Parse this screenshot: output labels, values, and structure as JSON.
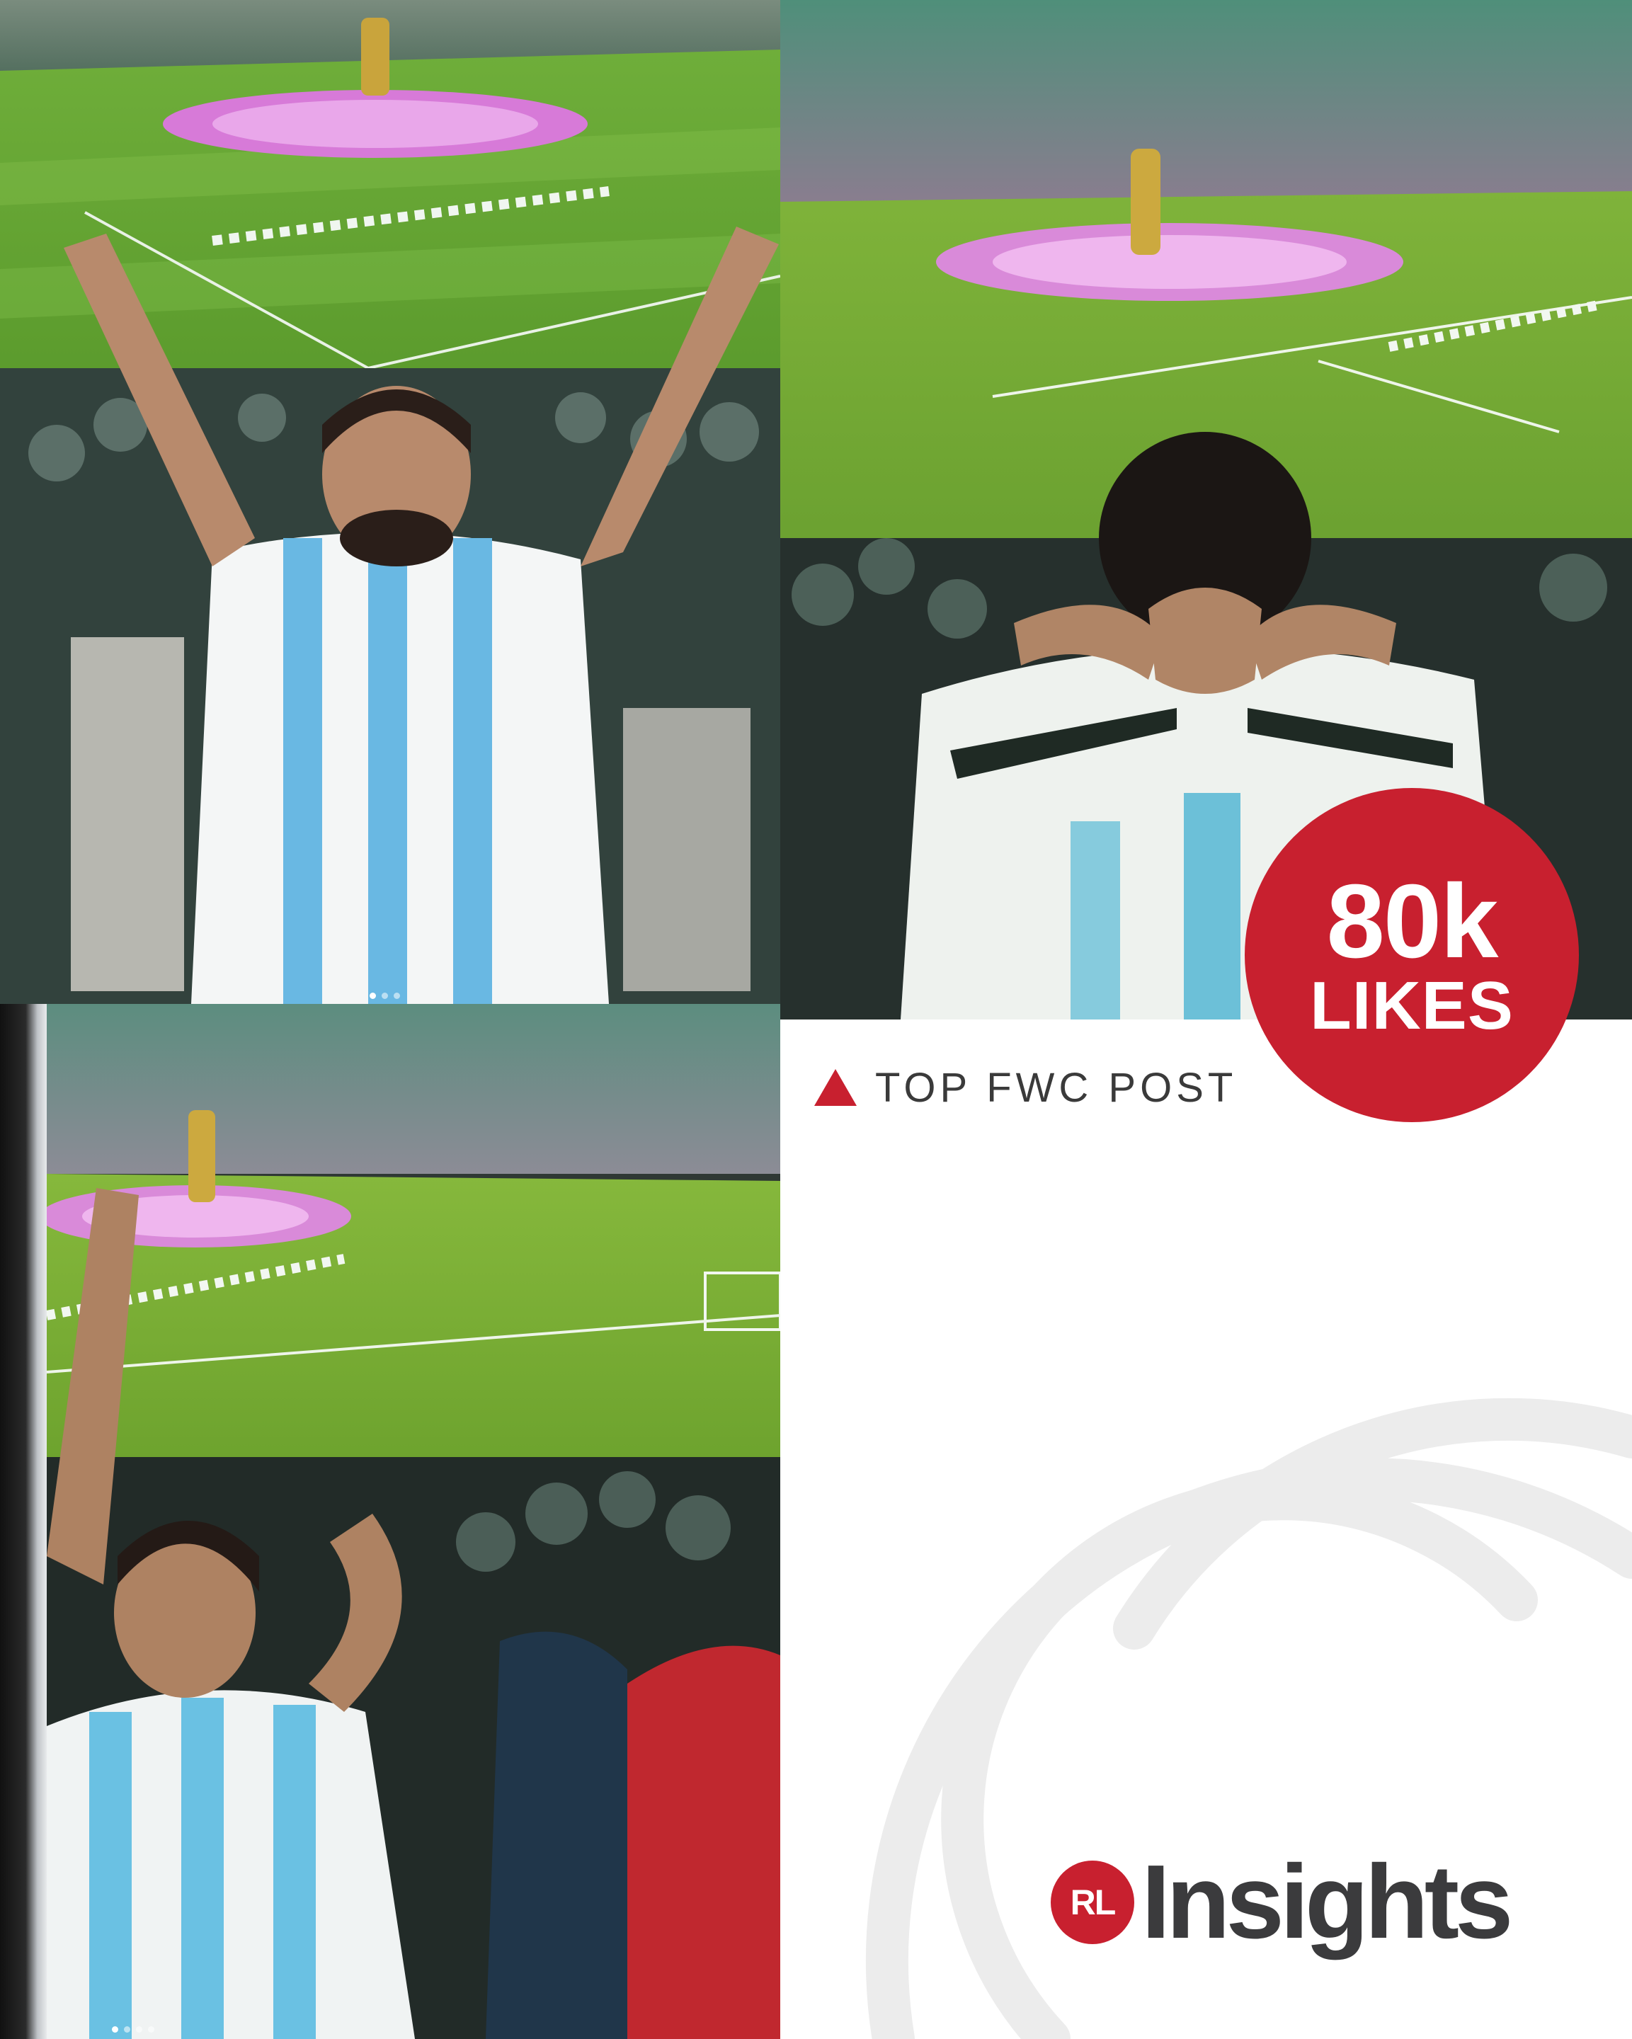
{
  "badge": {
    "count": "80k",
    "label": "LIKES"
  },
  "caption": {
    "text": "TOP FWC POST"
  },
  "brand": {
    "mark": "RL",
    "name": "Insights"
  },
  "colors": {
    "accent": "#c8202f",
    "brand_text": "#3b3b3d",
    "swirl": "#ececec"
  },
  "photos": [
    {
      "id": "stadium-fan-arms-raised",
      "icon": "photo"
    },
    {
      "id": "stadium-fan-back-view",
      "icon": "photo"
    },
    {
      "id": "stadium-fan-celebrating",
      "icon": "photo"
    }
  ]
}
